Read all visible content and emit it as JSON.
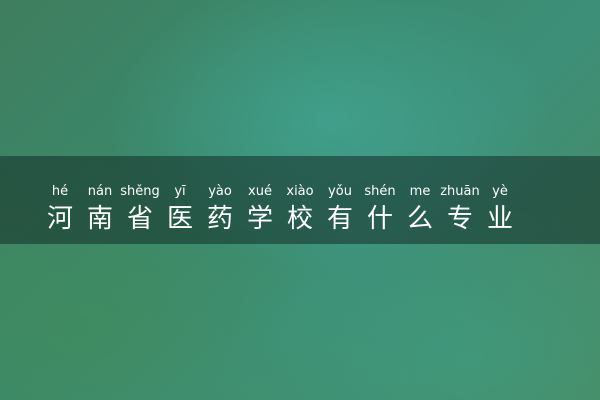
{
  "title": {
    "characters": [
      {
        "hanzi": "河",
        "pinyin": "hé"
      },
      {
        "hanzi": "南",
        "pinyin": "nán"
      },
      {
        "hanzi": "省",
        "pinyin": "shěng"
      },
      {
        "hanzi": "医",
        "pinyin": "yī"
      },
      {
        "hanzi": "药",
        "pinyin": "yào"
      },
      {
        "hanzi": "学",
        "pinyin": "xué"
      },
      {
        "hanzi": "校",
        "pinyin": "xiào"
      },
      {
        "hanzi": "有",
        "pinyin": "yǒu"
      },
      {
        "hanzi": "什",
        "pinyin": "shén"
      },
      {
        "hanzi": "么",
        "pinyin": "me"
      },
      {
        "hanzi": "专",
        "pinyin": "zhuān"
      },
      {
        "hanzi": "业",
        "pinyin": "yè"
      }
    ]
  }
}
